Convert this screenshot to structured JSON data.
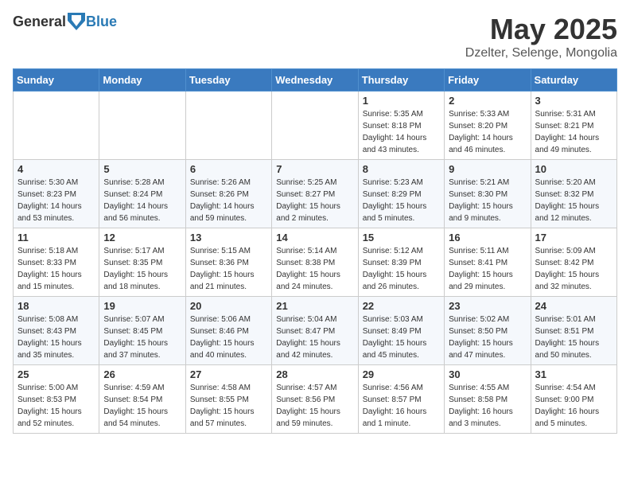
{
  "logo": {
    "text_general": "General",
    "text_blue": "Blue"
  },
  "title": "May 2025",
  "subtitle": "Dzelter, Selenge, Mongolia",
  "days_of_week": [
    "Sunday",
    "Monday",
    "Tuesday",
    "Wednesday",
    "Thursday",
    "Friday",
    "Saturday"
  ],
  "weeks": [
    [
      {
        "day": "",
        "info": ""
      },
      {
        "day": "",
        "info": ""
      },
      {
        "day": "",
        "info": ""
      },
      {
        "day": "",
        "info": ""
      },
      {
        "day": "1",
        "info": "Sunrise: 5:35 AM\nSunset: 8:18 PM\nDaylight: 14 hours\nand 43 minutes."
      },
      {
        "day": "2",
        "info": "Sunrise: 5:33 AM\nSunset: 8:20 PM\nDaylight: 14 hours\nand 46 minutes."
      },
      {
        "day": "3",
        "info": "Sunrise: 5:31 AM\nSunset: 8:21 PM\nDaylight: 14 hours\nand 49 minutes."
      }
    ],
    [
      {
        "day": "4",
        "info": "Sunrise: 5:30 AM\nSunset: 8:23 PM\nDaylight: 14 hours\nand 53 minutes."
      },
      {
        "day": "5",
        "info": "Sunrise: 5:28 AM\nSunset: 8:24 PM\nDaylight: 14 hours\nand 56 minutes."
      },
      {
        "day": "6",
        "info": "Sunrise: 5:26 AM\nSunset: 8:26 PM\nDaylight: 14 hours\nand 59 minutes."
      },
      {
        "day": "7",
        "info": "Sunrise: 5:25 AM\nSunset: 8:27 PM\nDaylight: 15 hours\nand 2 minutes."
      },
      {
        "day": "8",
        "info": "Sunrise: 5:23 AM\nSunset: 8:29 PM\nDaylight: 15 hours\nand 5 minutes."
      },
      {
        "day": "9",
        "info": "Sunrise: 5:21 AM\nSunset: 8:30 PM\nDaylight: 15 hours\nand 9 minutes."
      },
      {
        "day": "10",
        "info": "Sunrise: 5:20 AM\nSunset: 8:32 PM\nDaylight: 15 hours\nand 12 minutes."
      }
    ],
    [
      {
        "day": "11",
        "info": "Sunrise: 5:18 AM\nSunset: 8:33 PM\nDaylight: 15 hours\nand 15 minutes."
      },
      {
        "day": "12",
        "info": "Sunrise: 5:17 AM\nSunset: 8:35 PM\nDaylight: 15 hours\nand 18 minutes."
      },
      {
        "day": "13",
        "info": "Sunrise: 5:15 AM\nSunset: 8:36 PM\nDaylight: 15 hours\nand 21 minutes."
      },
      {
        "day": "14",
        "info": "Sunrise: 5:14 AM\nSunset: 8:38 PM\nDaylight: 15 hours\nand 24 minutes."
      },
      {
        "day": "15",
        "info": "Sunrise: 5:12 AM\nSunset: 8:39 PM\nDaylight: 15 hours\nand 26 minutes."
      },
      {
        "day": "16",
        "info": "Sunrise: 5:11 AM\nSunset: 8:41 PM\nDaylight: 15 hours\nand 29 minutes."
      },
      {
        "day": "17",
        "info": "Sunrise: 5:09 AM\nSunset: 8:42 PM\nDaylight: 15 hours\nand 32 minutes."
      }
    ],
    [
      {
        "day": "18",
        "info": "Sunrise: 5:08 AM\nSunset: 8:43 PM\nDaylight: 15 hours\nand 35 minutes."
      },
      {
        "day": "19",
        "info": "Sunrise: 5:07 AM\nSunset: 8:45 PM\nDaylight: 15 hours\nand 37 minutes."
      },
      {
        "day": "20",
        "info": "Sunrise: 5:06 AM\nSunset: 8:46 PM\nDaylight: 15 hours\nand 40 minutes."
      },
      {
        "day": "21",
        "info": "Sunrise: 5:04 AM\nSunset: 8:47 PM\nDaylight: 15 hours\nand 42 minutes."
      },
      {
        "day": "22",
        "info": "Sunrise: 5:03 AM\nSunset: 8:49 PM\nDaylight: 15 hours\nand 45 minutes."
      },
      {
        "day": "23",
        "info": "Sunrise: 5:02 AM\nSunset: 8:50 PM\nDaylight: 15 hours\nand 47 minutes."
      },
      {
        "day": "24",
        "info": "Sunrise: 5:01 AM\nSunset: 8:51 PM\nDaylight: 15 hours\nand 50 minutes."
      }
    ],
    [
      {
        "day": "25",
        "info": "Sunrise: 5:00 AM\nSunset: 8:53 PM\nDaylight: 15 hours\nand 52 minutes."
      },
      {
        "day": "26",
        "info": "Sunrise: 4:59 AM\nSunset: 8:54 PM\nDaylight: 15 hours\nand 54 minutes."
      },
      {
        "day": "27",
        "info": "Sunrise: 4:58 AM\nSunset: 8:55 PM\nDaylight: 15 hours\nand 57 minutes."
      },
      {
        "day": "28",
        "info": "Sunrise: 4:57 AM\nSunset: 8:56 PM\nDaylight: 15 hours\nand 59 minutes."
      },
      {
        "day": "29",
        "info": "Sunrise: 4:56 AM\nSunset: 8:57 PM\nDaylight: 16 hours\nand 1 minute."
      },
      {
        "day": "30",
        "info": "Sunrise: 4:55 AM\nSunset: 8:58 PM\nDaylight: 16 hours\nand 3 minutes."
      },
      {
        "day": "31",
        "info": "Sunrise: 4:54 AM\nSunset: 9:00 PM\nDaylight: 16 hours\nand 5 minutes."
      }
    ]
  ]
}
